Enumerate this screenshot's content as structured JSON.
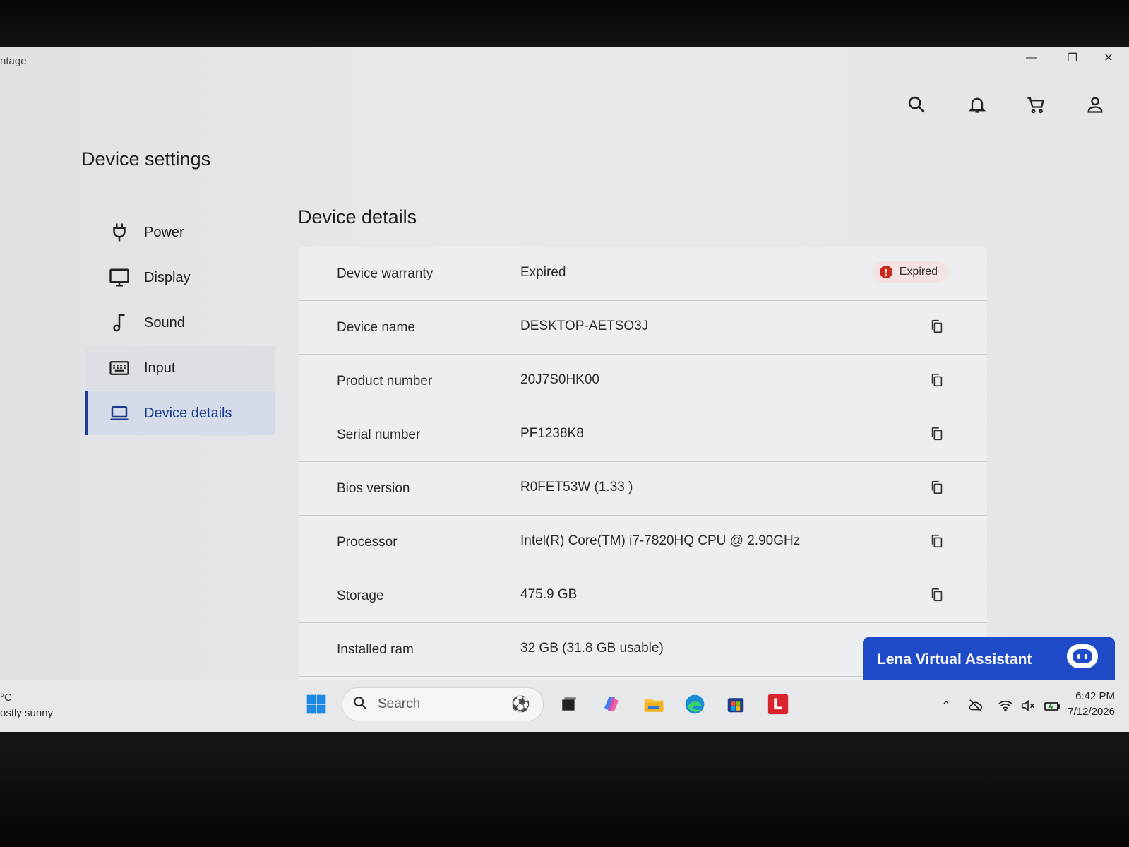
{
  "app": {
    "title": "ntage"
  },
  "window_controls": {
    "minimize": "—",
    "restore": "❐",
    "close": "✕"
  },
  "header_icons": [
    "search-icon",
    "bell-icon",
    "cart-icon",
    "account-icon"
  ],
  "page": {
    "heading": "Device settings",
    "section_title": "Device details"
  },
  "sidebar": {
    "items": [
      {
        "label": "Power",
        "icon": "plug-icon"
      },
      {
        "label": "Display",
        "icon": "monitor-icon"
      },
      {
        "label": "Sound",
        "icon": "music-note-icon"
      },
      {
        "label": "Input",
        "icon": "keyboard-icon"
      },
      {
        "label": "Device details",
        "icon": "laptop-icon",
        "active": true
      }
    ]
  },
  "details": {
    "rows": [
      {
        "key": "Device warranty",
        "value": "Expired",
        "badge": "Expired"
      },
      {
        "key": "Device name",
        "value": "DESKTOP-AETSO3J"
      },
      {
        "key": "Product number",
        "value": "20J7S0HK00"
      },
      {
        "key": "Serial number",
        "value": "PF1238K8"
      },
      {
        "key": "Bios version",
        "value": "R0FET53W (1.33 )"
      },
      {
        "key": "Processor",
        "value": "Intel(R) Core(TM) i7-7820HQ CPU @ 2.90GHz"
      },
      {
        "key": "Storage",
        "value": "475.9 GB"
      },
      {
        "key": "Installed ram",
        "value": "32 GB (31.8 GB usable)"
      }
    ]
  },
  "assistant": {
    "label": "Lena Virtual Assistant"
  },
  "taskbar": {
    "weather": {
      "temp": "°C",
      "desc": "ostly sunny"
    },
    "search_placeholder": "Search",
    "clock": {
      "time": "6:42 PM",
      "date": "7/12/2026"
    }
  },
  "colors": {
    "accent": "#1c3d99",
    "assistant": "#1f4bc8",
    "expired_badge": "#c42b1c"
  }
}
